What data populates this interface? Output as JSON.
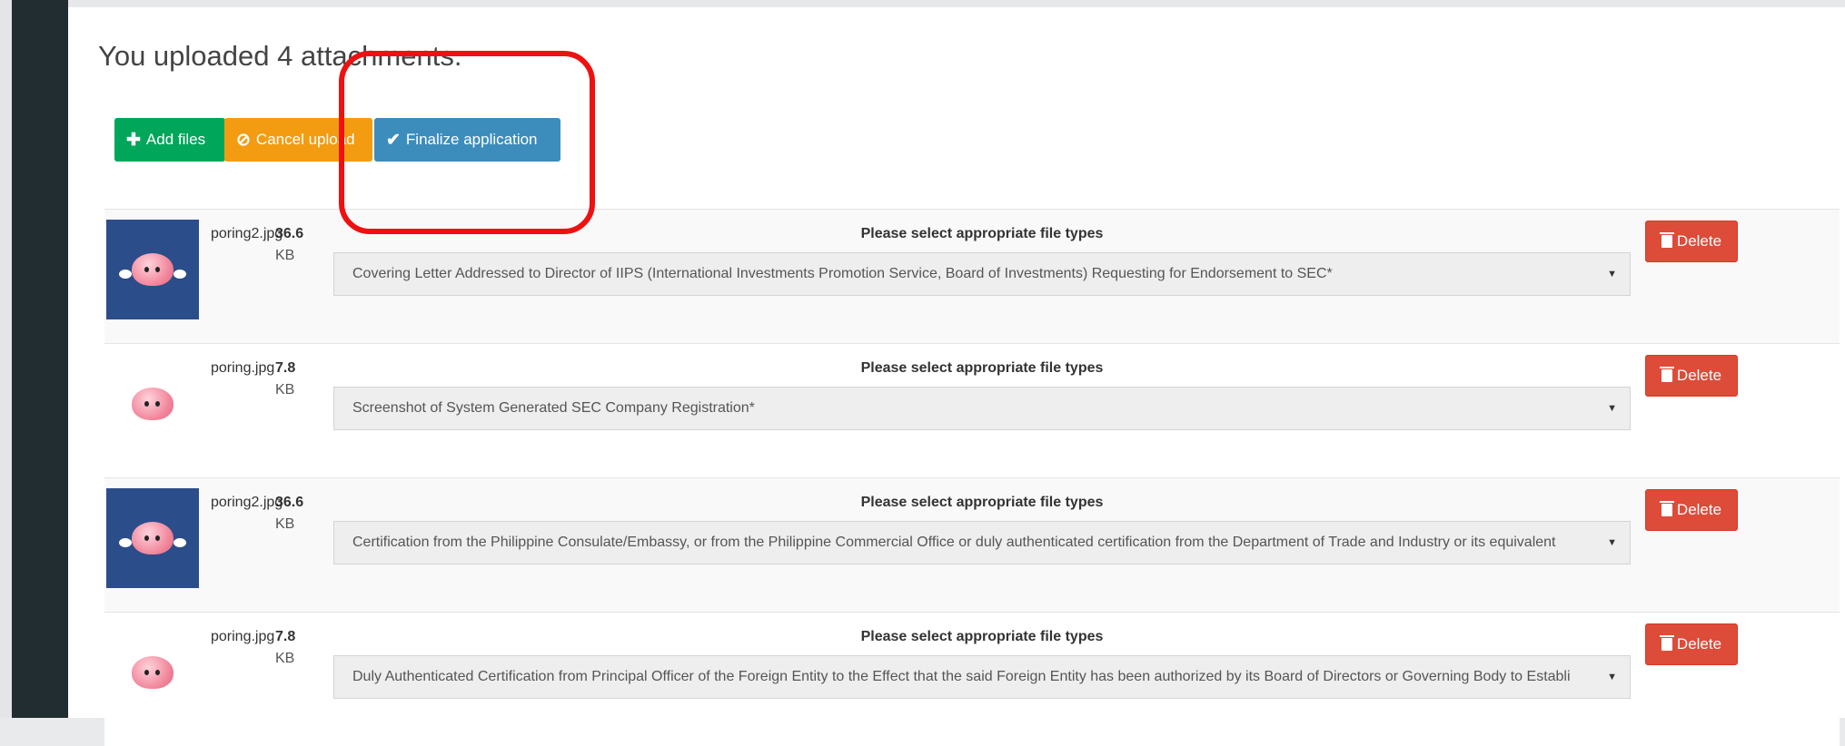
{
  "heading": "You uploaded 4 attachments.",
  "buttons": {
    "add_files": "Add files",
    "cancel_upload": "Cancel upload",
    "finalize": "Finalize application"
  },
  "colors": {
    "add": "#00a65a",
    "cancel": "#f39c12",
    "finalize": "#3c8dbc",
    "delete": "#dd4b39",
    "annotation": "#ee1111"
  },
  "attachments": [
    {
      "file_name": "poring2.jpg",
      "size": "36.6",
      "unit": "KB",
      "type_label": "Please select appropriate file types",
      "selected_type": "Covering Letter Addressed to Director of IIPS (International Investments Promotion Service, Board of Investments) Requesting for Endorsement to SEC*",
      "delete_label": "Delete",
      "thumbnail": "poring-angel"
    },
    {
      "file_name": "poring.jpg",
      "size": "7.8",
      "unit": "KB",
      "type_label": "Please select appropriate file types",
      "selected_type": "Screenshot of System Generated SEC Company Registration*",
      "delete_label": "Delete",
      "thumbnail": "poring"
    },
    {
      "file_name": "poring2.jpg",
      "size": "36.6",
      "unit": "KB",
      "type_label": "Please select appropriate file types",
      "selected_type": "Certification from the Philippine Consulate/Embassy, or from the Philippine Commercial Office or duly authenticated certification from the Department of Trade and Industry or its equivalent",
      "delete_label": "Delete",
      "thumbnail": "poring-angel"
    },
    {
      "file_name": "poring.jpg",
      "size": "7.8",
      "unit": "KB",
      "type_label": "Please select appropriate file types",
      "selected_type": "Duly Authenticated Certification from Principal Officer of the Foreign Entity to the Effect that the said Foreign Entity has been authorized by its Board of Directors or Governing Body to Establi",
      "delete_label": "Delete",
      "thumbnail": "poring"
    }
  ]
}
